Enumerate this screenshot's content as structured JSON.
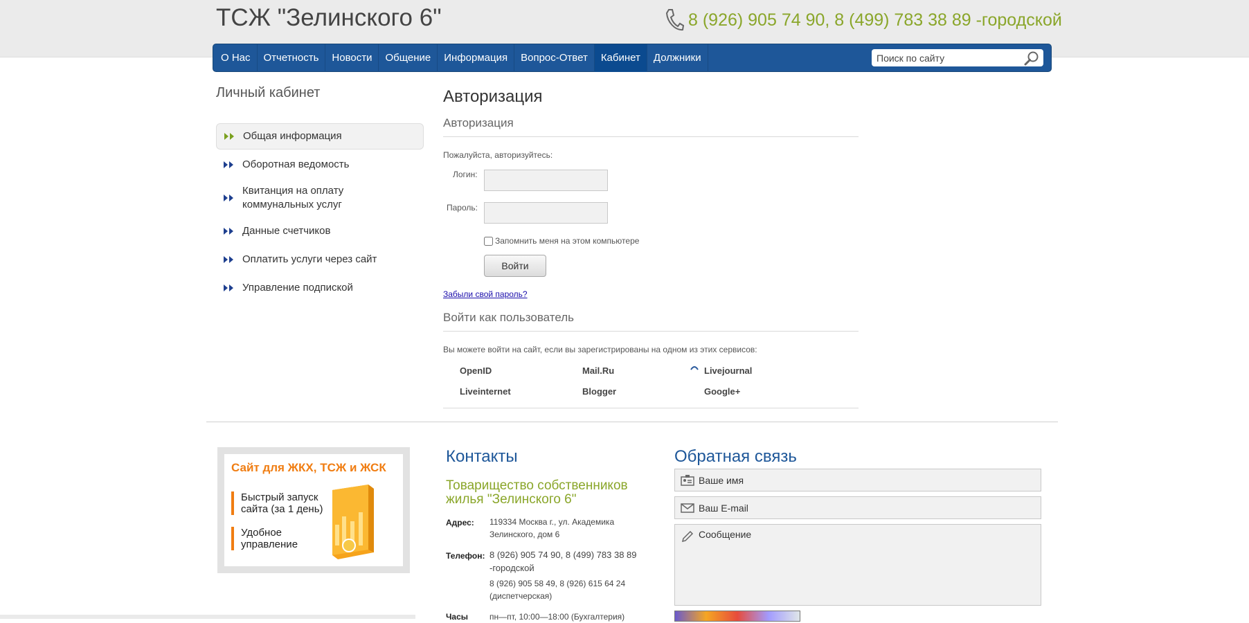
{
  "header": {
    "site_title": "ТСЖ \"Зелинского 6\"",
    "phone": "8 (926) 905 74 90, 8 (499) 783 38 89 -городской"
  },
  "nav": {
    "items": [
      {
        "label": "О Нас"
      },
      {
        "label": "Отчетность"
      },
      {
        "label": "Новости"
      },
      {
        "label": "Общение"
      },
      {
        "label": "Информация"
      },
      {
        "label": "Вопрос-Ответ"
      },
      {
        "label": "Кабинет",
        "active": true
      },
      {
        "label": "Должники"
      }
    ],
    "search_placeholder": "Поиск по сайту"
  },
  "sidebar": {
    "title": "Личный кабинет",
    "items": [
      {
        "label": "Общая информация",
        "active": true
      },
      {
        "label": "Оборотная ведомость"
      },
      {
        "label": "Квитанция на оплату коммунальных услуг"
      },
      {
        "label": "Данные счетчиков"
      },
      {
        "label": "Оплатить услуги через сайт"
      },
      {
        "label": "Управление подпиской"
      }
    ]
  },
  "auth": {
    "page_title": "Авторизация",
    "section_title": "Авторизация",
    "prompt": "Пожалуйста, авторизуйтесь:",
    "login_label": "Логин:",
    "password_label": "Пароль:",
    "login_value": "",
    "password_value": "",
    "remember_label": "Запомнить меня на этом компьютере",
    "remember_checked": false,
    "submit_label": "Войти",
    "forgot_link": "Забыли свой пароль?"
  },
  "social": {
    "title": "Войти как пользователь",
    "description": "Вы можете войти на сайт, если вы зарегистрированы на одном из этих сервисов:",
    "services": [
      {
        "label": "OpenID"
      },
      {
        "label": "Mail.Ru"
      },
      {
        "label": "Livejournal"
      },
      {
        "label": "Liveinternet"
      },
      {
        "label": "Blogger"
      },
      {
        "label": "Google+"
      }
    ]
  },
  "promo": {
    "title": "Сайт для ЖКХ, ТСЖ и ЖСК",
    "feature1_line1": "Быстрый запуск",
    "feature1_line2": "сайта (за 1 день)",
    "feature2_line1": "Удобное",
    "feature2_line2": "управление"
  },
  "contacts": {
    "title": "Контакты",
    "org_name": "Товарищество собственников жилья \"Зелинского 6\"",
    "address_label": "Адрес:",
    "address_value": "119334 Москва г., ул. Академика Зелинского, дом 6",
    "phone_label": "Телефон:",
    "phone_value1": "8 (926) 905 74 90, 8 (499) 783 38 89 -городской",
    "phone_value2": "8 (926) 905 58 49, 8 (926) 615 64 24 (диспетчерская)",
    "hours_label": "Часы",
    "hours_value": "пн—пт, 10:00—18:00 (Бухгалтерия)"
  },
  "feedback": {
    "title": "Обратная связь",
    "name_placeholder": "Ваше имя",
    "email_placeholder": "Ваш E-mail",
    "message_placeholder": "Сообщение"
  },
  "colors": {
    "brand_blue": "#1e5799",
    "accent_green": "#8aa62a",
    "promo_orange": "#f07d12"
  }
}
